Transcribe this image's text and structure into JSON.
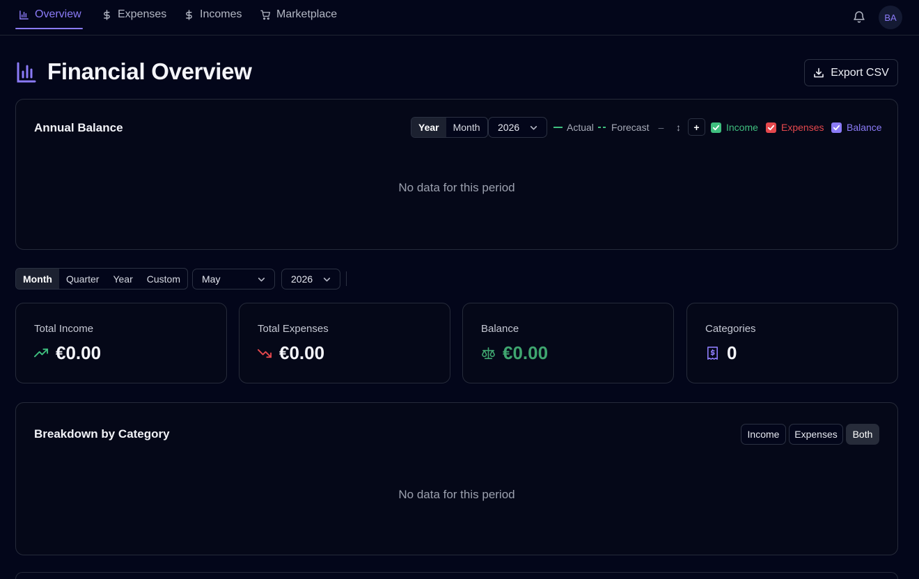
{
  "nav": {
    "items": [
      {
        "label": "Overview",
        "icon": "bar-chart-icon",
        "active": true
      },
      {
        "label": "Expenses",
        "icon": "dollar-icon",
        "active": false
      },
      {
        "label": "Incomes",
        "icon": "dollar-icon",
        "active": false
      },
      {
        "label": "Marketplace",
        "icon": "cart-icon",
        "active": false
      }
    ],
    "avatar_initials": "BA"
  },
  "header": {
    "title": "Financial Overview",
    "export_label": "Export CSV"
  },
  "annual_balance": {
    "title": "Annual Balance",
    "view_options": [
      "Year",
      "Month"
    ],
    "selected_view": "Year",
    "year": "2026",
    "legend_actual": "Actual",
    "legend_forecast": "Forecast",
    "zoom_out_label": "–",
    "reset_label": "↕",
    "zoom_in_label": "+",
    "toggles": [
      {
        "label": "Income",
        "checked": true,
        "color": "#3fbf7f"
      },
      {
        "label": "Expenses",
        "checked": true,
        "color": "#e5484d"
      },
      {
        "label": "Balance",
        "checked": true,
        "color": "#8b7bf7"
      }
    ],
    "empty_message": "No data for this period"
  },
  "period_filter": {
    "options": [
      "Month",
      "Quarter",
      "Year",
      "Custom"
    ],
    "selected": "Month",
    "month": "May",
    "year": "2026"
  },
  "stats": [
    {
      "label": "Total Income",
      "value": "€0.00",
      "icon": "trending-up-icon",
      "color": "#3fbf7f"
    },
    {
      "label": "Total Expenses",
      "value": "€0.00",
      "icon": "trending-down-icon",
      "color": "#e5484d"
    },
    {
      "label": "Balance",
      "value": "€0.00",
      "icon": "scale-icon",
      "color": "#3fa56f"
    },
    {
      "label": "Categories",
      "value": "0",
      "icon": "receipt-icon",
      "color": "#8b7bf7"
    }
  ],
  "breakdown": {
    "title": "Breakdown by Category",
    "filters": [
      "Income",
      "Expenses",
      "Both"
    ],
    "selected_filter": "Both",
    "empty_message": "No data for this period"
  },
  "colors": {
    "accent": "#8b7bf7",
    "income": "#3fbf7f",
    "expense": "#e5484d"
  }
}
